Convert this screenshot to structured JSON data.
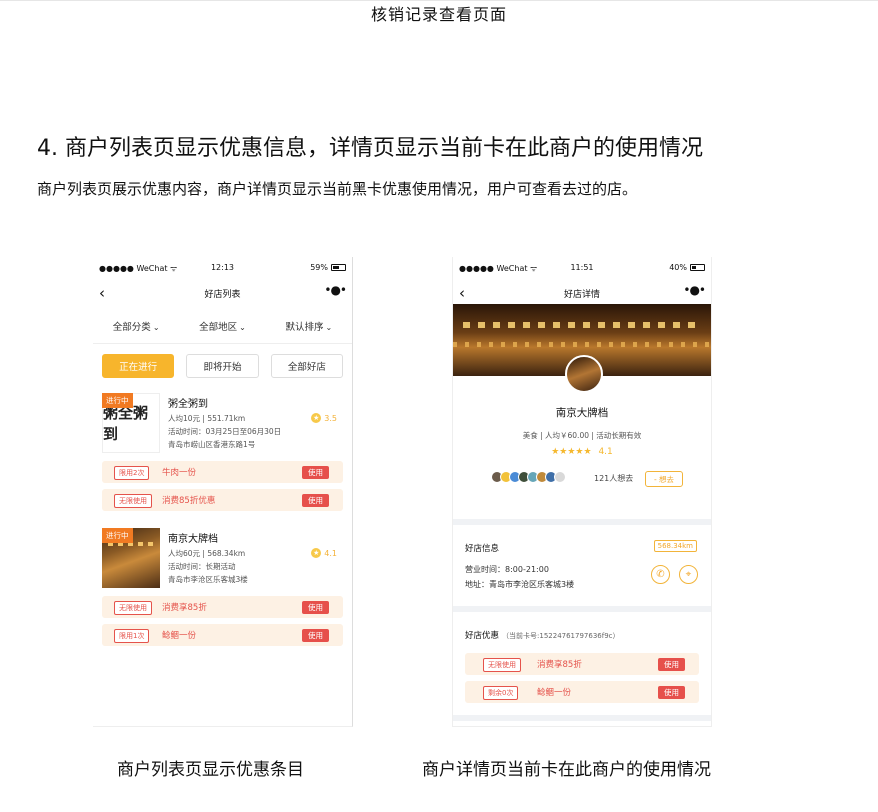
{
  "doc": {
    "title": "核销记录查看页面",
    "section_heading": "4. 商户列表页显示优惠信息，详情页显示当前卡在此商户的使用情况",
    "section_desc": "商户列表页展示优惠内容，商户详情页显示当前黑卡优惠使用情况，用户可查看去过的店。",
    "caption_left": "商户列表页显示优惠条目",
    "caption_right": "商户详情页当前卡在此商户的使用情况"
  },
  "list_phone": {
    "status": {
      "carrier": "●●●●● WeChat ᯤ",
      "time": "12:13",
      "battery": "59%",
      "battery_level": 0.59
    },
    "nav": {
      "back": "‹",
      "title": "好店列表",
      "more": "•●•"
    },
    "filters": [
      {
        "label": "全部分类"
      },
      {
        "label": "全部地区"
      },
      {
        "label": "默认排序"
      }
    ],
    "chevron": "⌄",
    "tabs": [
      {
        "label": "正在进行",
        "active": true
      },
      {
        "label": "即将开始",
        "active": false
      },
      {
        "label": "全部好店",
        "active": false
      }
    ],
    "shops": [
      {
        "ribbon": "进行中",
        "logo_text": "粥全粥到",
        "name": "粥全粥到",
        "line1": "人均10元 | 551.71km",
        "line2": "活动时间：03月25日至06月30日",
        "line3": "青岛市崂山区香港东路1号",
        "rating": "3.5",
        "star": "★"
      },
      {
        "ribbon": "进行中",
        "name": "南京大牌档",
        "line1": "人均60元 | 568.34km",
        "line2": "活动时间：长期活动",
        "line3": "青岛市李沧区乐客城3楼",
        "rating": "4.1",
        "star": "★"
      }
    ],
    "coupons": [
      {
        "tag": "限用2次",
        "desc": "牛肉一份",
        "button": "使用"
      },
      {
        "tag": "无限使用",
        "desc": "消费85折优惠",
        "button": "使用"
      },
      {
        "tag": "无限使用",
        "desc": "消费享85折",
        "button": "使用"
      },
      {
        "tag": "限用1次",
        "desc": "鲶鲴一份",
        "button": "使用"
      }
    ]
  },
  "detail_phone": {
    "status": {
      "carrier": "●●●●● WeChat ᯤ",
      "time": "11:51",
      "battery": "40%",
      "battery_level": 0.4
    },
    "nav": {
      "back": "‹",
      "title": "好店详情",
      "more": "•●•"
    },
    "name": "南京大牌档",
    "meta": "美食 | 人均￥60.00 | 活动长期有效",
    "stars": "★★★★★",
    "rating": "4.1",
    "visitors_count": "121人想去",
    "want_button": "- 想去",
    "visitor_colors": [
      "#6b5b4b",
      "#f2c23a",
      "#4a8bd6",
      "#3f4f3a",
      "#66a6b8",
      "#c08a3a",
      "#3f6fa8",
      "#d9d9d9"
    ],
    "info": {
      "title": "好店信息",
      "distance": "568.34km",
      "hours": "营业时间：8:00-21:00",
      "address": "地址：青岛市李沧区乐客城3楼",
      "phone_icon": "✆",
      "location_icon": "⌖"
    },
    "offers": {
      "title": "好店优惠",
      "card_no": "（当前卡号:15224761797636f9c）",
      "items": [
        {
          "tag": "无限使用",
          "desc": "消费享85折",
          "button": "使用"
        },
        {
          "tag": "剩余0次",
          "desc": "鲶鲴一份",
          "button": "使用"
        }
      ]
    }
  },
  "colors": {
    "accent": "#f7b52c",
    "ribbon": "#f17a22",
    "coupon_red": "#e6504b",
    "coupon_bg": "#fdf1e4"
  }
}
